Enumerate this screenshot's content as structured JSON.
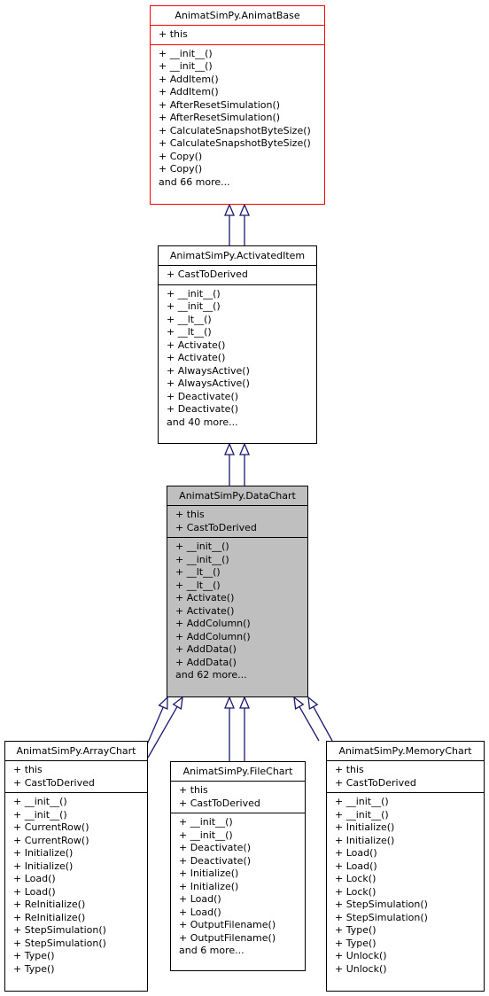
{
  "classes": {
    "animat_base": {
      "name": "AnimatSimPy.AnimatBase",
      "attributes": [
        "+ this"
      ],
      "operations": [
        "+ __init__()",
        "+ __init__()",
        "+ AddItem()",
        "+ AddItem()",
        "+ AfterResetSimulation()",
        "+ AfterResetSimulation()",
        "+ CalculateSnapshotByteSize()",
        "+ CalculateSnapshotByteSize()",
        "+ Copy()",
        "+ Copy()",
        "and 66 more..."
      ]
    },
    "activated_item": {
      "name": "AnimatSimPy.ActivatedItem",
      "attributes": [
        "+ CastToDerived"
      ],
      "operations": [
        "+ __init__()",
        "+ __init__()",
        "+ __lt__()",
        "+ __lt__()",
        "+ Activate()",
        "+ Activate()",
        "+ AlwaysActive()",
        "+ AlwaysActive()",
        "+ Deactivate()",
        "+ Deactivate()",
        "and 40 more..."
      ]
    },
    "data_chart": {
      "name": "AnimatSimPy.DataChart",
      "attributes": [
        "+ this",
        "+ CastToDerived"
      ],
      "operations": [
        "+ __init__()",
        "+ __init__()",
        "+ __lt__()",
        "+ __lt__()",
        "+ Activate()",
        "+ Activate()",
        "+ AddColumn()",
        "+ AddColumn()",
        "+ AddData()",
        "+ AddData()",
        "and 62 more..."
      ]
    },
    "array_chart": {
      "name": "AnimatSimPy.ArrayChart",
      "attributes": [
        "+ this",
        "+ CastToDerived"
      ],
      "operations": [
        "+ __init__()",
        "+ __init__()",
        "+ CurrentRow()",
        "+ CurrentRow()",
        "+ Initialize()",
        "+ Initialize()",
        "+ Load()",
        "+ Load()",
        "+ ReInitialize()",
        "+ ReInitialize()",
        "+ StepSimulation()",
        "+ StepSimulation()",
        "+ Type()",
        "+ Type()"
      ]
    },
    "file_chart": {
      "name": "AnimatSimPy.FileChart",
      "attributes": [
        "+ this",
        "+ CastToDerived"
      ],
      "operations": [
        "+ __init__()",
        "+ __init__()",
        "+ Deactivate()",
        "+ Deactivate()",
        "+ Initialize()",
        "+ Initialize()",
        "+ Load()",
        "+ Load()",
        "+ OutputFilename()",
        "+ OutputFilename()",
        "and 6 more..."
      ]
    },
    "memory_chart": {
      "name": "AnimatSimPy.MemoryChart",
      "attributes": [
        "+ this",
        "+ CastToDerived"
      ],
      "operations": [
        "+ __init__()",
        "+ __init__()",
        "+ Initialize()",
        "+ Initialize()",
        "+ Load()",
        "+ Load()",
        "+ Lock()",
        "+ Lock()",
        "+ StepSimulation()",
        "+ StepSimulation()",
        "+ Type()",
        "+ Type()",
        "+ Unlock()",
        "+ Unlock()"
      ]
    }
  },
  "inheritance": [
    {
      "child": "activated_item",
      "parent": "animat_base"
    },
    {
      "child": "activated_item",
      "parent": "animat_base"
    },
    {
      "child": "data_chart",
      "parent": "activated_item"
    },
    {
      "child": "data_chart",
      "parent": "activated_item"
    },
    {
      "child": "array_chart",
      "parent": "data_chart"
    },
    {
      "child": "array_chart",
      "parent": "data_chart"
    },
    {
      "child": "file_chart",
      "parent": "data_chart"
    },
    {
      "child": "file_chart",
      "parent": "data_chart"
    },
    {
      "child": "memory_chart",
      "parent": "data_chart"
    },
    {
      "child": "memory_chart",
      "parent": "data_chart"
    }
  ],
  "colors": {
    "edge": "#191970",
    "base_border": "#ff0000",
    "focus_fill": "#bfbfbf"
  }
}
